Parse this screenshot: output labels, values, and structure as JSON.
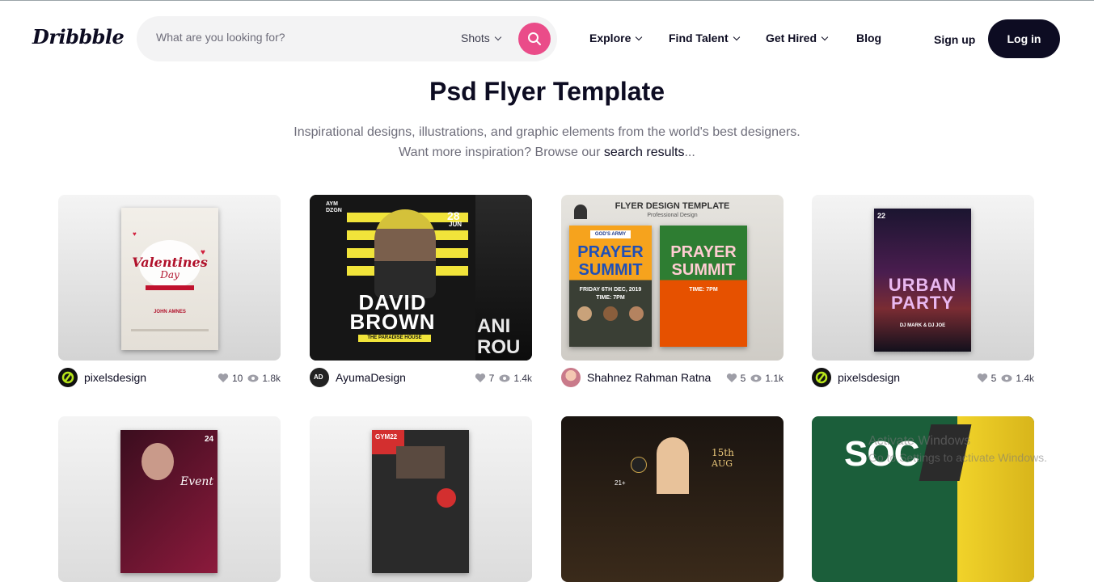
{
  "header": {
    "logo": "Dribbble",
    "search_placeholder": "What are you looking for?",
    "search_scope": "Shots",
    "nav": [
      "Explore",
      "Find Talent",
      "Get Hired",
      "Blog"
    ],
    "signup": "Sign up",
    "login": "Log in"
  },
  "hero": {
    "title": "Psd Flyer Template",
    "line1": "Inspirational designs, illustrations, and graphic elements from the world's best designers.",
    "line2_prefix": "Want more inspiration? Browse our ",
    "line2_link": "search results",
    "line2_suffix": "..."
  },
  "shots": [
    {
      "author": "pixelsdesign",
      "likes": "10",
      "views": "1.8k",
      "art": {
        "line1": "Valentines",
        "line2": "Day",
        "line3": "JOHN AMNES"
      }
    },
    {
      "author": "AyumaDesign",
      "likes": "7",
      "views": "1.4k",
      "art": {
        "brand": "AYM DZGN",
        "date_day": "28",
        "date_month": "JUN",
        "line1": "DAVID",
        "line2": "BROWN",
        "line3": "THE PARADISE HOUSE",
        "side": "ANI ROU"
      }
    },
    {
      "author": "Shahnez Rahman Ratna",
      "likes": "5",
      "views": "1.1k",
      "art": {
        "title": "FLYER DESIGN TEMPLATE",
        "subtitle": "Professional Design",
        "line1": "PRAYER",
        "line2": "SUMMIT",
        "line3": "FRIDAY 6TH DEC, 2019",
        "line4": "TIME: 7PM",
        "badge": "GOD'S ARMY"
      }
    },
    {
      "author": "pixelsdesign",
      "likes": "5",
      "views": "1.4k",
      "art": {
        "line1": "URBAN",
        "line2": "PARTY",
        "line3": "DJ MARK & DJ JOE",
        "date": "22"
      }
    },
    {
      "art": {
        "date": "24",
        "line1": "Event"
      }
    },
    {
      "art": {
        "line1": "GYM22"
      }
    },
    {
      "art": {
        "line1": "15th",
        "line2": "AUG",
        "line3": "21+"
      }
    },
    {
      "art": {
        "line1": "SOC"
      }
    }
  ],
  "colors": {
    "brand_pink": "#ea4c89",
    "dark": "#0d0c22",
    "gray_text": "#6e6d7a",
    "search_bg": "#f3f3f4"
  },
  "watermark": {
    "line1": "Activate Windows",
    "line2": "Go to Settings to activate Windows."
  }
}
